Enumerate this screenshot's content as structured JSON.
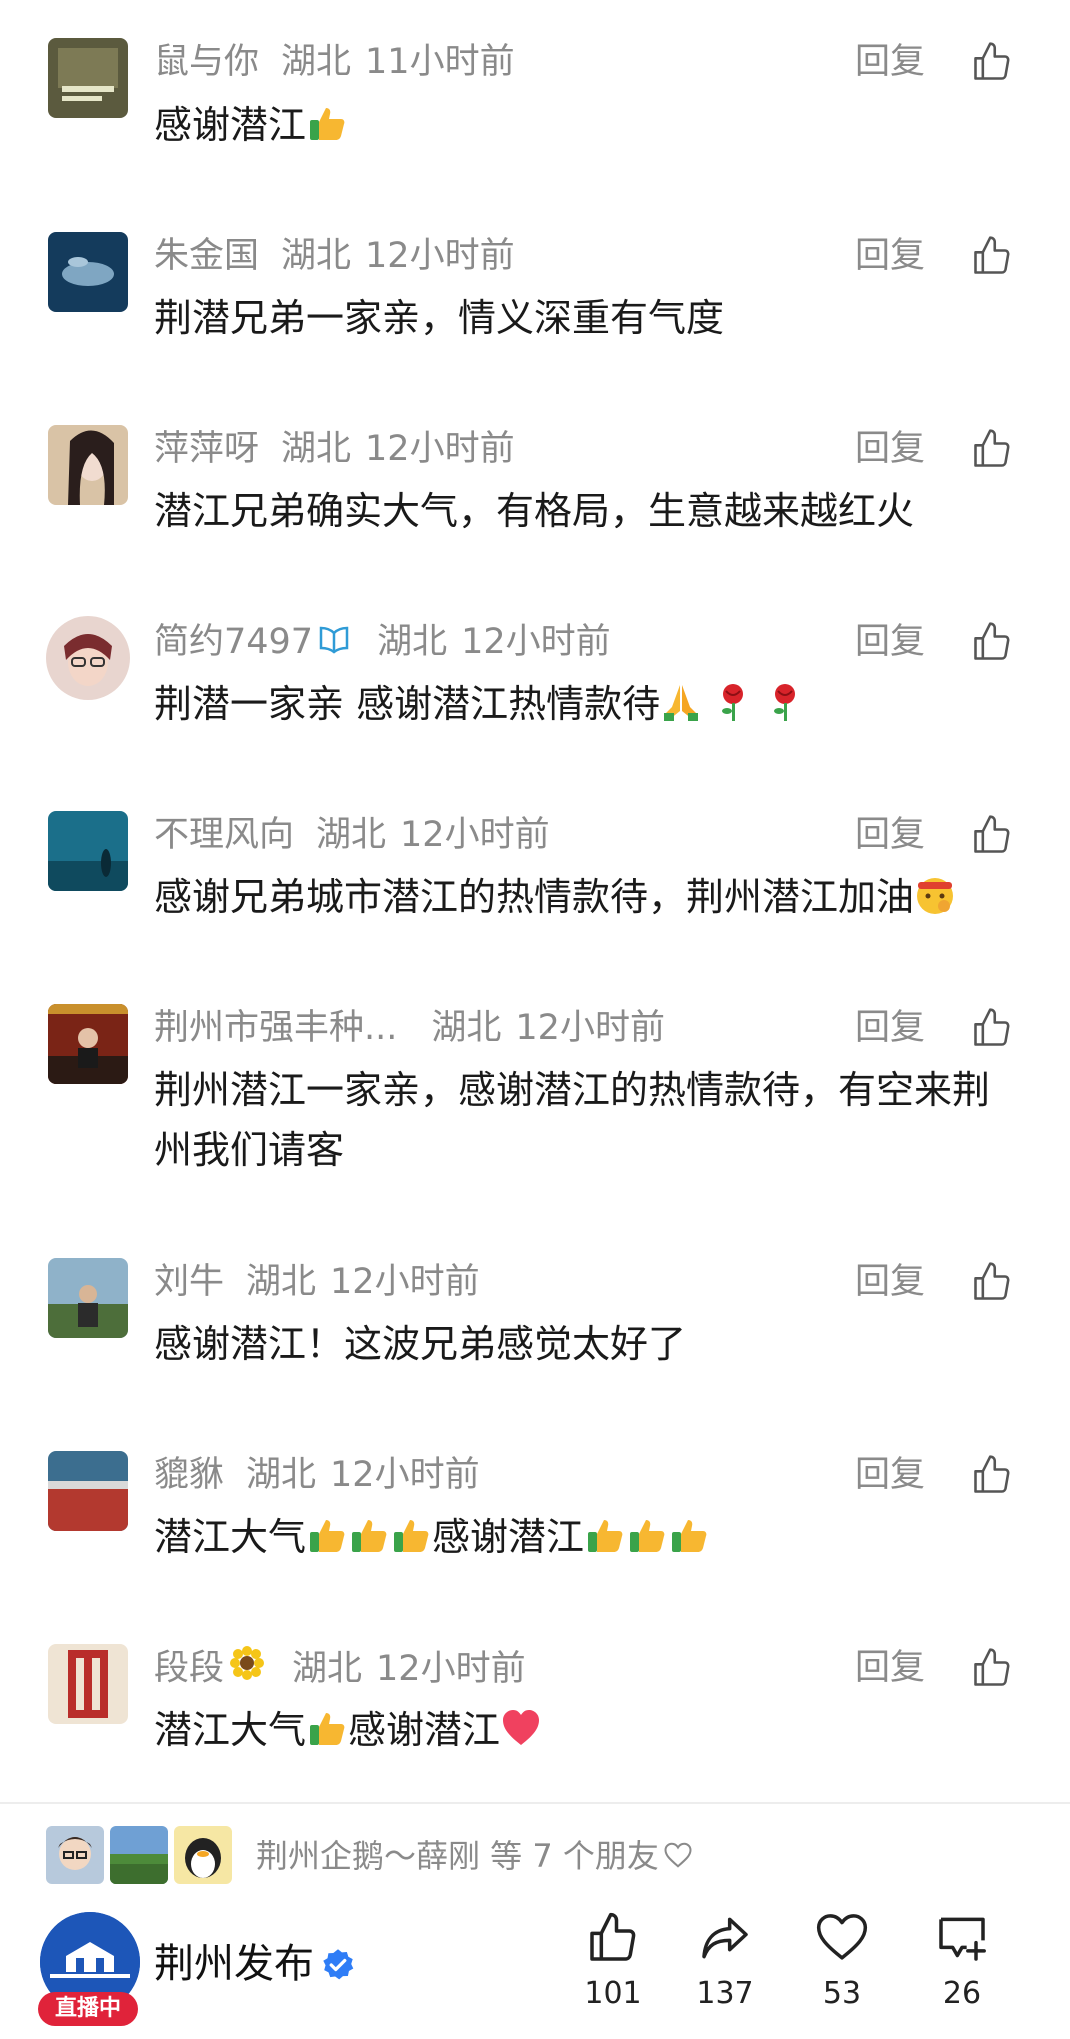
{
  "comments": [
    {
      "name": "鼠与你",
      "location": "湖北",
      "time": "11小时前",
      "text": "感谢潜江",
      "emojis": [
        "thumbs-up"
      ],
      "reply_label": "回复"
    },
    {
      "name": "朱金国",
      "location": "湖北",
      "time": "12小时前",
      "text": "荆潜兄弟一家亲，情义深重有气度",
      "emojis": [],
      "reply_label": "回复"
    },
    {
      "name": "萍萍呀",
      "location": "湖北",
      "time": "12小时前",
      "text": "潜江兄弟确实大气，有格局，生意越来越红火",
      "emojis": [],
      "reply_label": "回复"
    },
    {
      "name": "简约7497",
      "location": "湖北",
      "time": "12小时前",
      "text": "荆潜一家亲 感谢潜江热情款待",
      "emojis": [
        "pray",
        "rose",
        "rose"
      ],
      "reply_label": "回复"
    },
    {
      "name": "不理风向",
      "location": "湖北",
      "time": "12小时前",
      "text": "感谢兄弟城市潜江的热情款待，荆州潜江加油",
      "emojis": [
        "fighting"
      ],
      "reply_label": "回复"
    },
    {
      "name": "荆州市强丰种...",
      "location": "湖北",
      "time": "12小时前",
      "text": "荆州潜江一家亲，感谢潜江的热情款待，有空来荆州我们请客",
      "emojis": [],
      "reply_label": "回复"
    },
    {
      "name": "刘牛",
      "location": "湖北",
      "time": "12小时前",
      "text": "感谢潜江！这波兄弟感觉太好了",
      "emojis": [],
      "reply_label": "回复"
    },
    {
      "name": "貔貅",
      "location": "湖北",
      "time": "12小时前",
      "text_a": "潜江大气",
      "text_b": "感谢潜江",
      "emojis_a": [
        "thumbs-up",
        "thumbs-up",
        "thumbs-up"
      ],
      "emojis_b": [
        "thumbs-up",
        "thumbs-up",
        "thumbs-up"
      ],
      "reply_label": "回复"
    },
    {
      "name": "段段",
      "location": "湖北",
      "time": "12小时前",
      "text_a": "潜江大气",
      "text_b": "感谢潜江",
      "emojis_a": [
        "thumbs-up"
      ],
      "emojis_b": [
        "heart"
      ],
      "reply_label": "回复"
    }
  ],
  "friends_bar": {
    "text": "荆州企鹅～薛刚 等 7 个朋友"
  },
  "account": {
    "name": "荆州发布",
    "live_label": "直播中"
  },
  "actions": {
    "like_count": "101",
    "share_count": "137",
    "favorite_count": "53",
    "comment_count": "26"
  },
  "colors": {
    "meta_gray": "#8a8a8a",
    "verified_blue": "#2f7df6",
    "live_red": "#e0233a"
  }
}
